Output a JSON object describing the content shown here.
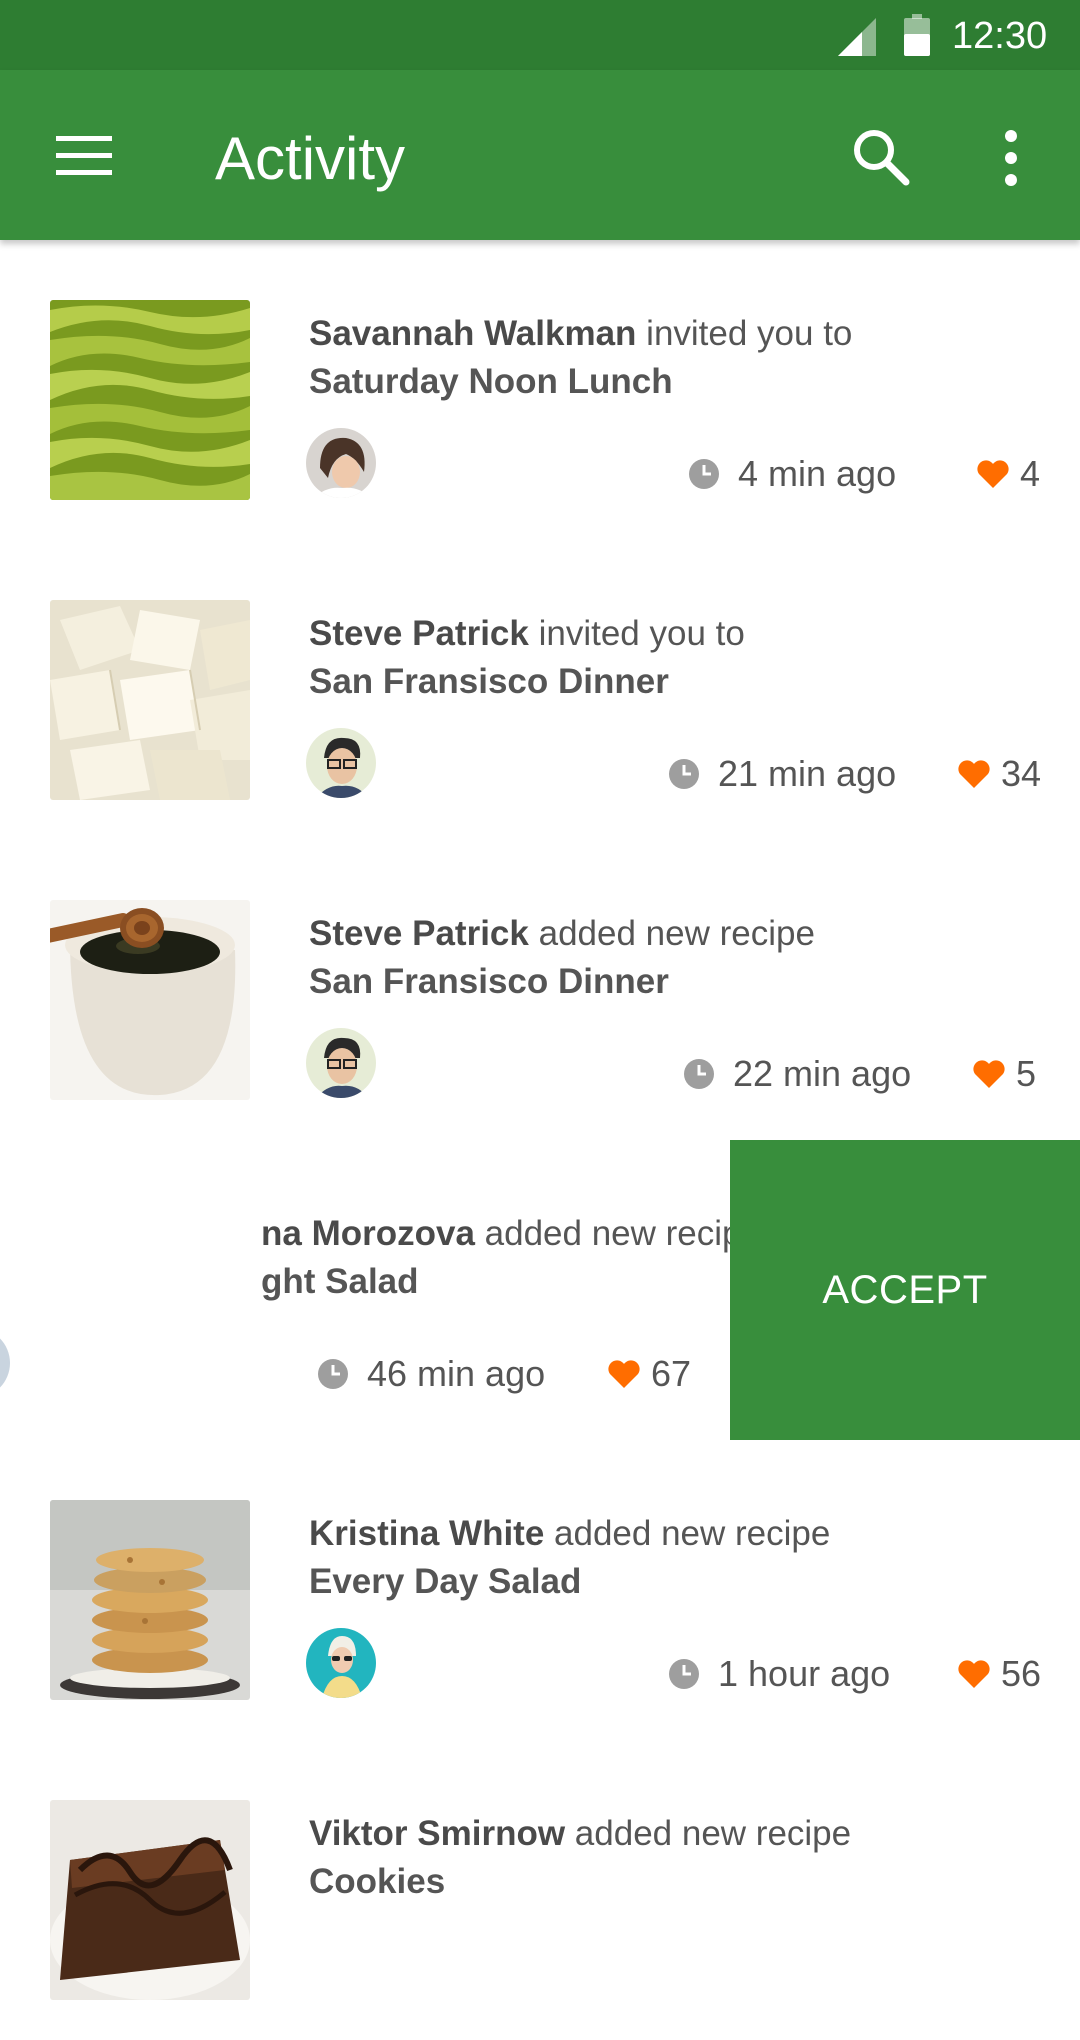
{
  "status_bar": {
    "time": "12:30"
  },
  "app_bar": {
    "title": "Activity"
  },
  "colors": {
    "primary": "#388e3c",
    "primary_dark": "#2e7d32",
    "heart": "#ff6d00"
  },
  "feed": [
    {
      "name": "Savannah Walkman",
      "action": " invited you to",
      "title": "Saturday Noon Lunch",
      "time": "4 min ago",
      "likes": "4",
      "thumb": "green-beans"
    },
    {
      "name": "Steve Patrick",
      "action": " invited you to",
      "title": "San Fransisco Dinner",
      "time": "21 min ago",
      "likes": "34",
      "thumb": "white-chocolate"
    },
    {
      "name": "Steve Patrick",
      "action": " added new recipe",
      "title": "San Fransisco Dinner",
      "time": "22 min ago",
      "likes": "5",
      "thumb": "honey-cup"
    },
    {
      "name": "na Morozova",
      "action": " added new recipe",
      "title": "ght Salad",
      "time": "46 min ago",
      "likes": "67",
      "accept": "ACCEPT"
    },
    {
      "name": "Kristina White",
      "action": " added new recipe",
      "title": "Every Day Salad",
      "time": "1 hour ago",
      "likes": "56",
      "thumb": "cookies"
    },
    {
      "name": "Viktor Smirnow",
      "action": " added new recipe",
      "title": "Cookies",
      "thumb": "brownie"
    }
  ]
}
